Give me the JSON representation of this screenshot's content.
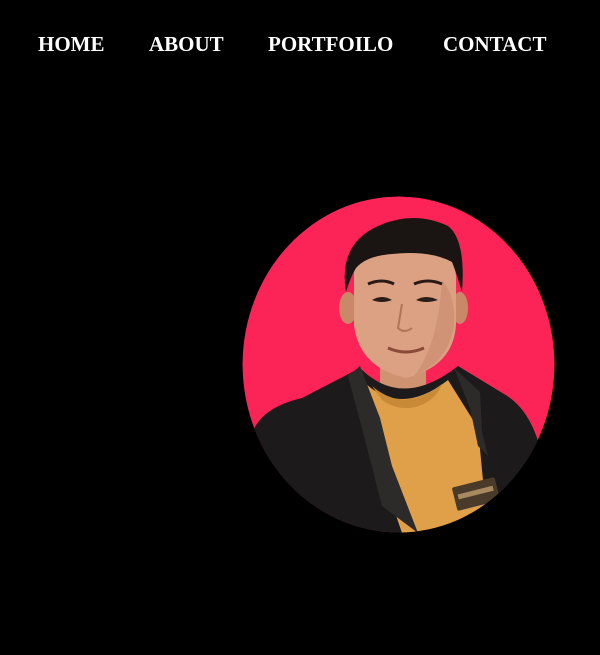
{
  "nav": {
    "items": [
      {
        "label": "HOME"
      },
      {
        "label": "ABOUT"
      },
      {
        "label": "PORTFOILO"
      },
      {
        "label": "CONTACT"
      }
    ]
  },
  "hero": {
    "photo": {
      "icon": "profile-photo-icon",
      "subject": "person in dark blazer and orange t-shirt",
      "background_color": "#fc2457",
      "shirt_color": "#e0a04a",
      "jacket_color": "#1c1a1a"
    }
  },
  "colors": {
    "page_background": "#000000",
    "nav_text": "#ffffff",
    "accent": "#fc2457"
  }
}
